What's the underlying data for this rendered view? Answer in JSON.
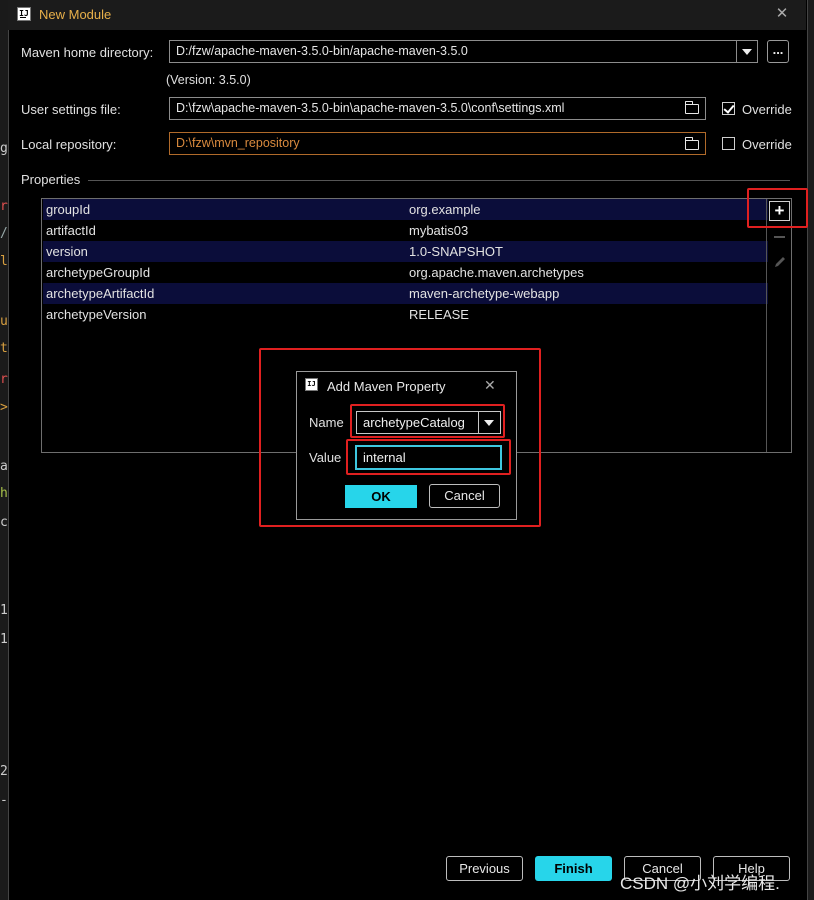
{
  "window": {
    "title": "New Module",
    "icon": "intellij-icon",
    "icon_text": "IJ"
  },
  "form": {
    "maven_home_label": "Maven home directory:",
    "maven_home_value": "D:/fzw/apache-maven-3.5.0-bin/apache-maven-3.5.0",
    "maven_version_note": "(Version: 3.5.0)",
    "user_settings_label": "User settings file:",
    "user_settings_value": "D:\\fzw\\apache-maven-3.5.0-bin\\apache-maven-3.5.0\\conf\\settings.xml",
    "user_settings_override_label": "Override",
    "user_settings_override_checked": true,
    "local_repo_label": "Local repository:",
    "local_repo_value": "D:\\fzw\\mvn_repository",
    "local_repo_override_label": "Override",
    "local_repo_override_checked": false,
    "browse_button_label": "..."
  },
  "properties": {
    "section_label": "Properties",
    "rows": [
      {
        "key": "groupId",
        "value": "org.example"
      },
      {
        "key": "artifactId",
        "value": "mybatis03"
      },
      {
        "key": "version",
        "value": "1.0-SNAPSHOT"
      },
      {
        "key": "archetypeGroupId",
        "value": "org.apache.maven.archetypes"
      },
      {
        "key": "archetypeArtifactId",
        "value": "maven-archetype-webapp"
      },
      {
        "key": "archetypeVersion",
        "value": "RELEASE"
      }
    ],
    "add_icon": "+"
  },
  "dialog": {
    "title": "Add Maven Property",
    "close_icon": "✕",
    "name_label": "Name",
    "name_value": "archetypeCatalog",
    "value_label": "Value",
    "value_value": "internal",
    "ok_label": "OK",
    "cancel_label": "Cancel"
  },
  "footer": {
    "previous_label": "Previous",
    "finish_label": "Finish",
    "cancel_label": "Cancel",
    "help_label": "Help"
  },
  "background_glyphs": [
    "g",
    "r",
    "/",
    "l",
    "u",
    "t",
    "r",
    ">",
    "a",
    "h",
    "c",
    "1",
    "1",
    "2",
    "-"
  ],
  "watermark": "CSDN @小刘学编程.",
  "colors": {
    "accent": "#27d5ea",
    "highlight": "#e02020",
    "row_alt": "#0b0d3a",
    "title": "#e8b04a"
  }
}
